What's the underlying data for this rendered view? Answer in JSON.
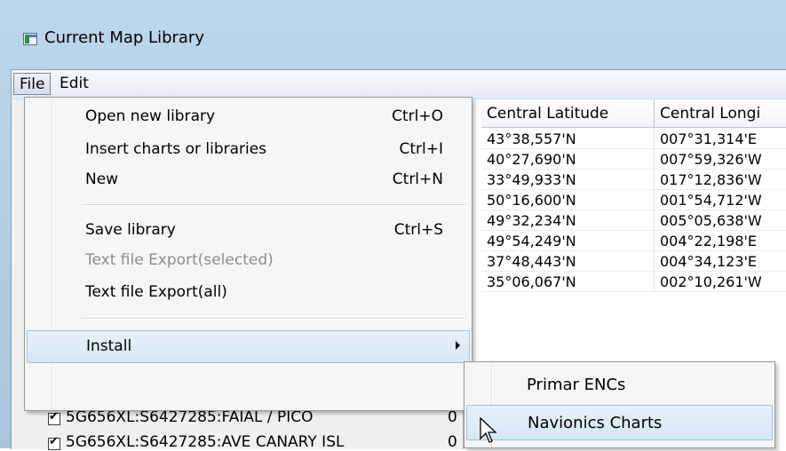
{
  "window": {
    "title": "Current Map Library"
  },
  "menubar": {
    "file": "File",
    "edit": "Edit"
  },
  "list": {
    "columns": [
      "Central Latitude",
      "Central Longi"
    ],
    "rows": [
      {
        "lat": "43°38,557'N",
        "lon": "007°31,314'E"
      },
      {
        "lat": "40°27,690'N",
        "lon": "007°59,326'W"
      },
      {
        "lat": "33°49,933'N",
        "lon": "017°12,836'W"
      },
      {
        "lat": "50°16,600'N",
        "lon": "001°54,712'W"
      },
      {
        "lat": "49°32,234'N",
        "lon": "005°05,638'W"
      },
      {
        "lat": "49°54,249'N",
        "lon": "004°22,198'E"
      },
      {
        "lat": "37°48,443'N",
        "lon": "004°34,123'E"
      },
      {
        "lat": "35°06,067'N",
        "lon": "002°10,261'W"
      }
    ],
    "charts": [
      {
        "name": "5G656XL:S6427285:FAIAL / PICO",
        "count": "0"
      },
      {
        "name": "5G656XL:S6427285:AVE CANARY ISL",
        "count": "0"
      }
    ]
  },
  "file_menu": {
    "items": [
      {
        "label": "Open new library",
        "shortcut": "Ctrl+O"
      },
      {
        "label": "Insert charts or libraries",
        "shortcut": "Ctrl+I"
      },
      {
        "label": "New",
        "shortcut": "Ctrl+N"
      },
      {
        "label": "Save library",
        "shortcut": "Ctrl+S"
      },
      {
        "label": "Text file Export(selected)",
        "shortcut": ""
      },
      {
        "label": "Text file Export(all)",
        "shortcut": ""
      },
      {
        "label": "Install",
        "shortcut": ""
      }
    ]
  },
  "install_submenu": {
    "items": [
      {
        "label": "Primar ENCs"
      },
      {
        "label": "Navionics Charts"
      }
    ]
  }
}
